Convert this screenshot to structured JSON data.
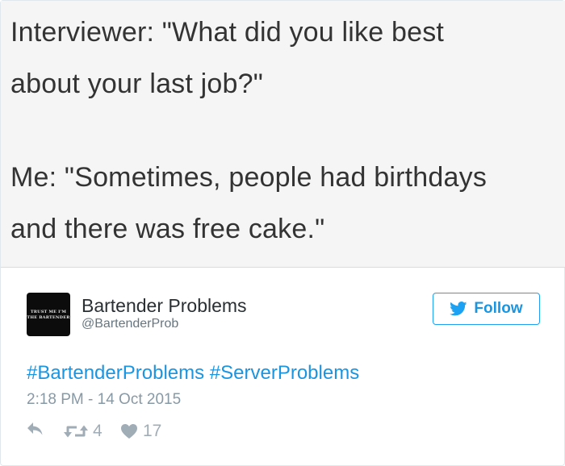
{
  "quote": {
    "line1": "Interviewer: \"What did you like best",
    "line2": "about your last job?\"",
    "line3": "Me: \"Sometimes, people had birthdays",
    "line4": "and there was free cake.\""
  },
  "author": {
    "name": "Bartender Problems",
    "handle": "@BartenderProb",
    "avatar_line1": "TRUST ME I'M",
    "avatar_line2": "THE BARTENDER"
  },
  "follow": {
    "label": "Follow",
    "icon": "twitter-bird-icon"
  },
  "tweet": {
    "hashtag1": "#BartenderProblems",
    "hashtag2": "#ServerProblems",
    "timestamp": "2:18 PM - 14 Oct 2015"
  },
  "actions": {
    "reply_icon": "reply-icon",
    "retweet_icon": "retweet-icon",
    "retweet_count": "4",
    "like_icon": "heart-icon",
    "like_count": "17"
  },
  "colors": {
    "link": "#1b95e0",
    "muted": "#8899a6",
    "action": "#a1adb6",
    "quote_bg": "#f5f5f5"
  }
}
